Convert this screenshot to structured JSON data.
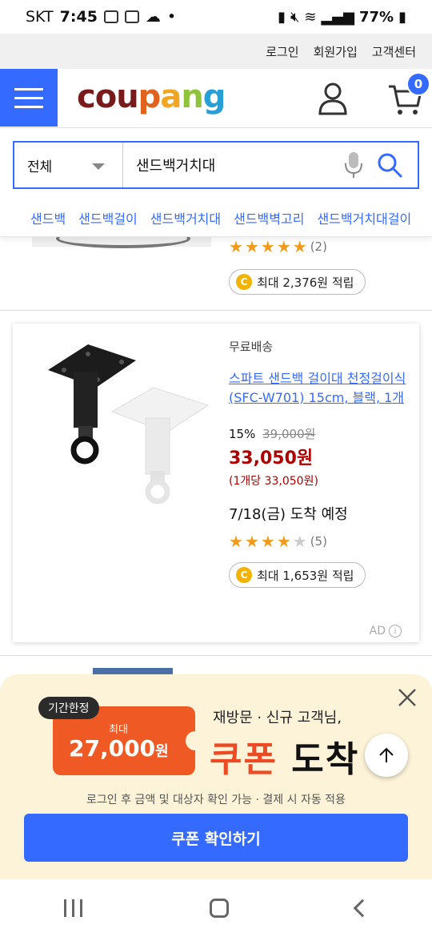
{
  "status_bar": {
    "carrier": "SKT",
    "time": "7:45",
    "battery": "77%"
  },
  "top_links": [
    "로그인",
    "회원가입",
    "고객센터"
  ],
  "header": {
    "logo": [
      "cou",
      "p",
      "a",
      "n",
      "g"
    ],
    "cart_count": "0"
  },
  "search": {
    "category": "전체",
    "query": "샌드백거치대"
  },
  "related_searches": [
    "샌드백",
    "샌드백걸이",
    "샌드백거치대",
    "샌드백벽고리",
    "샌드백거치대걸이"
  ],
  "prev_item": {
    "stars": 5,
    "rating_count": "(2)",
    "reward_coin": "C",
    "reward": "최대 2,376원 적립"
  },
  "product": {
    "shipping": "무료배송",
    "title": "스파트 샌드백 걸이대 천정걸이식(SFC-W701) 15cm, 블랙, 1개",
    "discount": "15%",
    "original_price": "39,000원",
    "price": "33,050원",
    "unit_price": "(1개당 33,050원)",
    "arrival": "7/18(금) 도착 예정",
    "stars": 4,
    "rating_count": "(5)",
    "reward_coin": "C",
    "reward": "최대 1,653원 적립",
    "ad_label": "AD",
    "ad_info": "i"
  },
  "coupon_popup": {
    "badge": "기간한정",
    "coupon_label": "최대",
    "coupon_amount": "27,000",
    "coupon_unit": "원",
    "subtitle": "재방문 · 신규 고객님,",
    "headline_red": "쿠폰",
    "headline_black": "도착",
    "note": "로그인 후 금액 및 대상자 확인 가능 · 결제 시 자동 적용",
    "button": "쿠폰 확인하기"
  },
  "colors": {
    "accent": "#346aff",
    "price_red": "#ae0000",
    "star": "#f39a1a",
    "coupon_orange": "#ef5a24",
    "popup_bg": "#fdf3d8"
  }
}
